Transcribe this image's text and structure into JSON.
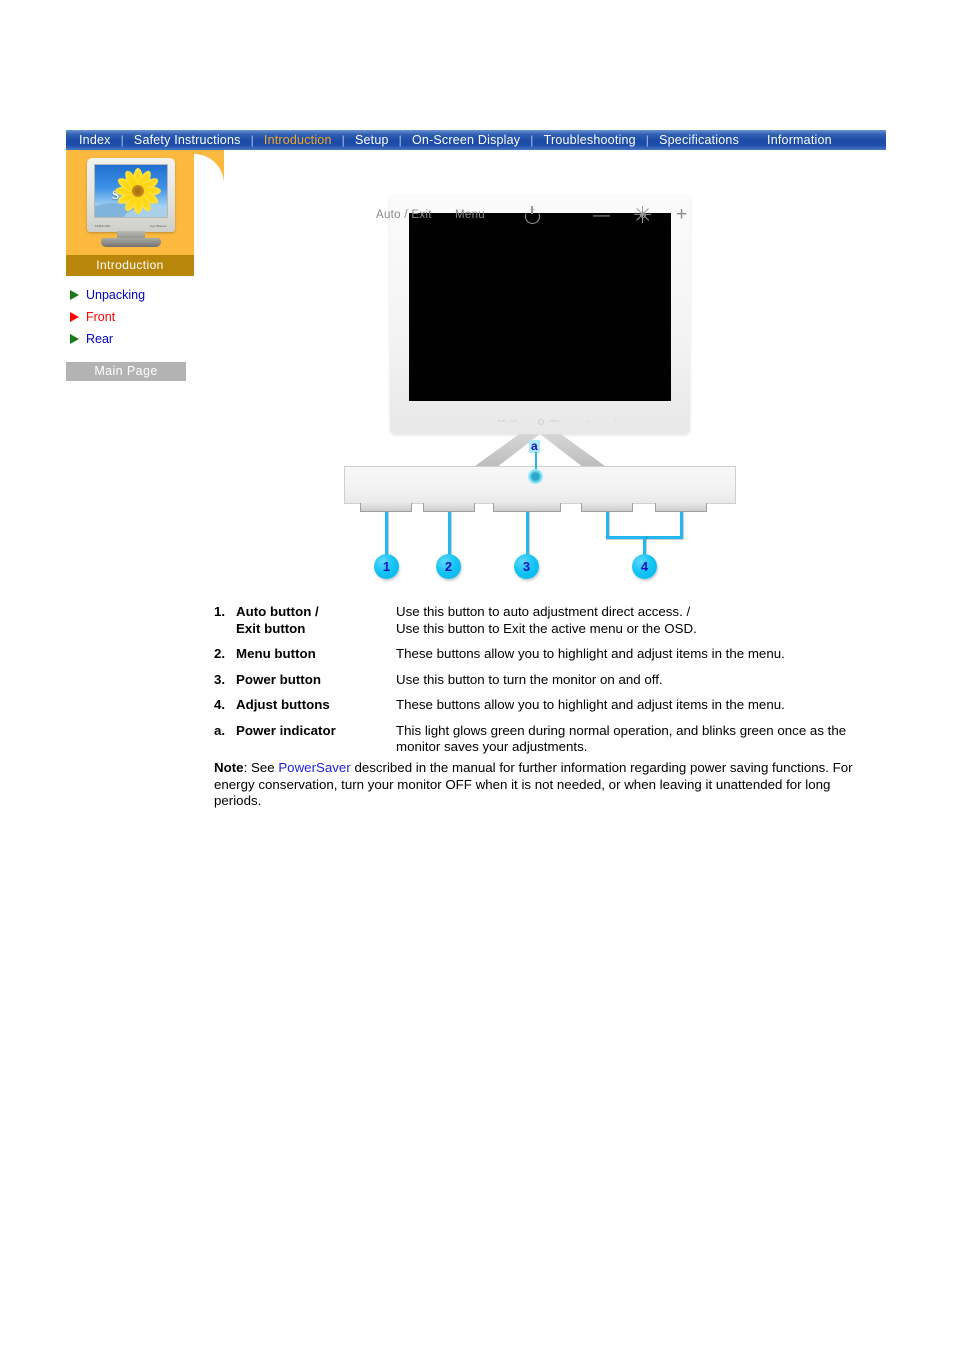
{
  "nav": {
    "items": [
      {
        "label": "Index",
        "active": false,
        "sep_after": true
      },
      {
        "label": "Safety Instructions",
        "active": false,
        "sep_after": true
      },
      {
        "label": "Introduction",
        "active": true,
        "sep_after": true
      },
      {
        "label": "Setup",
        "active": false,
        "sep_after": true
      },
      {
        "label": "On-Screen Display",
        "active": false,
        "sep_after": true
      },
      {
        "label": "Troubleshooting",
        "active": false,
        "sep_after": true
      },
      {
        "label": "Specifications",
        "active": false,
        "sep_after": false
      },
      {
        "label": "Information",
        "active": false,
        "sep_after": false
      }
    ],
    "separator": "|"
  },
  "sidebar": {
    "caption": "Introduction",
    "thumbnail_brand_left": "SAMSUNG",
    "thumbnail_brand_right": "SyncMaster",
    "thumbnail_letter": "S",
    "links": [
      {
        "label": "Unpacking",
        "current": false
      },
      {
        "label": "Front",
        "current": true
      },
      {
        "label": "Rear",
        "current": false
      }
    ],
    "main_page_label": "Main Page"
  },
  "figure": {
    "panel_labels": {
      "auto_exit": "Auto / Exit",
      "menu": "Menu",
      "minus": "—",
      "plus": "+"
    },
    "icons": {
      "power": "power-icon",
      "brightness": "brightness-icon",
      "indicator": "power-indicator-led"
    },
    "callouts": [
      {
        "id": "1"
      },
      {
        "id": "2"
      },
      {
        "id": "3"
      },
      {
        "id": "4"
      }
    ],
    "indicator_label": "a"
  },
  "descriptions": [
    {
      "num": "1.",
      "term": "Auto button /",
      "term2": "Exit button",
      "desc": "Use this button to auto adjustment direct access. /",
      "desc2": "Use this button to Exit the active menu or the OSD."
    },
    {
      "num": "2.",
      "term": "Menu button",
      "desc": "These buttons allow you to highlight and adjust items in the menu."
    },
    {
      "num": "3.",
      "term": "Power button",
      "desc": "Use this button to turn the monitor on and off."
    },
    {
      "num": "4.",
      "term": "Adjust buttons",
      "desc": "These buttons allow you to highlight and adjust items in the menu."
    },
    {
      "num": "a.",
      "term": "Power indicator",
      "desc": "This light glows green during normal operation, and blinks green once as the monitor saves your adjustments."
    }
  ],
  "note": {
    "label": "Note",
    "lead": ": See ",
    "link": "PowerSaver",
    "body": " described in the manual for further information regarding power saving functions. For energy conservation, turn your monitor OFF when it is not needed, or when leaving it unattended for long periods."
  },
  "colors": {
    "nav_blue": "#1b49a4",
    "nav_active": "#f5a623",
    "sidebar_orange": "#fbb93f",
    "sidebar_caption": "#b8860b",
    "link_blue": "#0000cc",
    "current_red": "#ff0000",
    "callout_cyan": "#00b4ec",
    "callout_number": "#1212c8",
    "main_page_gray": "#b3b3b3"
  }
}
